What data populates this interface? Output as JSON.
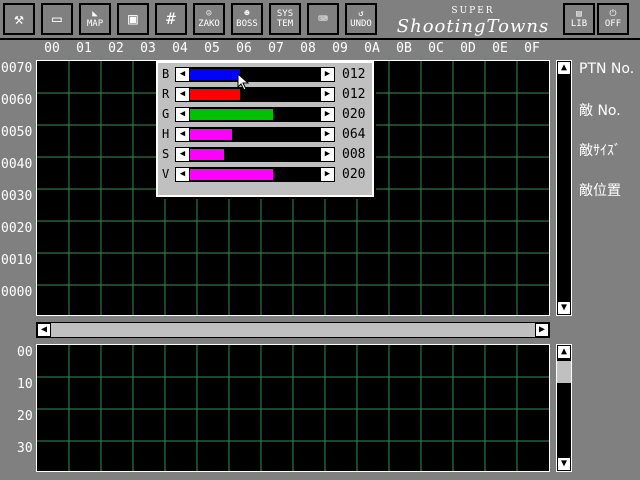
{
  "toolbar": {
    "buttons": [
      {
        "icon": "wrench-hammer-icon",
        "label": ""
      },
      {
        "icon": "drive-icon",
        "label": ""
      },
      {
        "icon": "japan-map-icon",
        "label": "MAP"
      },
      {
        "icon": "floppy-disk-icon",
        "label": ""
      },
      {
        "icon": "grid-icon",
        "label": ""
      },
      {
        "icon": "zako-enemy-icon",
        "label": "ZAKO"
      },
      {
        "icon": "boss-face-icon",
        "label": "BOSS"
      },
      {
        "icon": "sys-template-icon",
        "label": "SYS TEM"
      },
      {
        "icon": "keyboard-icon",
        "label": ""
      },
      {
        "icon": "undo-icon",
        "label": "UNDO"
      }
    ],
    "logo_small": "SUPER",
    "logo_text": "ShootingTowns",
    "lib_label": "LIB",
    "off_label": "OFF"
  },
  "columns": [
    "00",
    "01",
    "02",
    "03",
    "04",
    "05",
    "06",
    "07",
    "08",
    "09",
    "0A",
    "0B",
    "0C",
    "0D",
    "0E",
    "0F"
  ],
  "rows_upper": [
    "0070",
    "0060",
    "0050",
    "0040",
    "0030",
    "0020",
    "0010",
    "0000"
  ],
  "rows_lower": [
    "00",
    "10",
    "20",
    "30"
  ],
  "right_labels": {
    "ptn": "PTN No.",
    "enemy_no": "敵 No.",
    "enemy_size": "敵ｻｲｽﾞ",
    "enemy_pos": "敵位置"
  },
  "color_dialog": {
    "sliders": [
      {
        "label": "B",
        "value": "012",
        "level": 0.375,
        "color": "#0000ff"
      },
      {
        "label": "R",
        "value": "012",
        "level": 0.375,
        "color": "#ff0000"
      },
      {
        "label": "G",
        "value": "020",
        "level": 0.625,
        "color": "#00c000"
      },
      {
        "label": "H",
        "value": "064",
        "level": 0.32,
        "color": "#ff00ff"
      },
      {
        "label": "S",
        "value": "008",
        "level": 0.26,
        "color": "#ff00ff"
      },
      {
        "label": "V",
        "value": "020",
        "level": 0.625,
        "color": "#ff00ff"
      }
    ]
  },
  "colors": {
    "grid_line": "#2f8f4f",
    "background": "#808080"
  }
}
